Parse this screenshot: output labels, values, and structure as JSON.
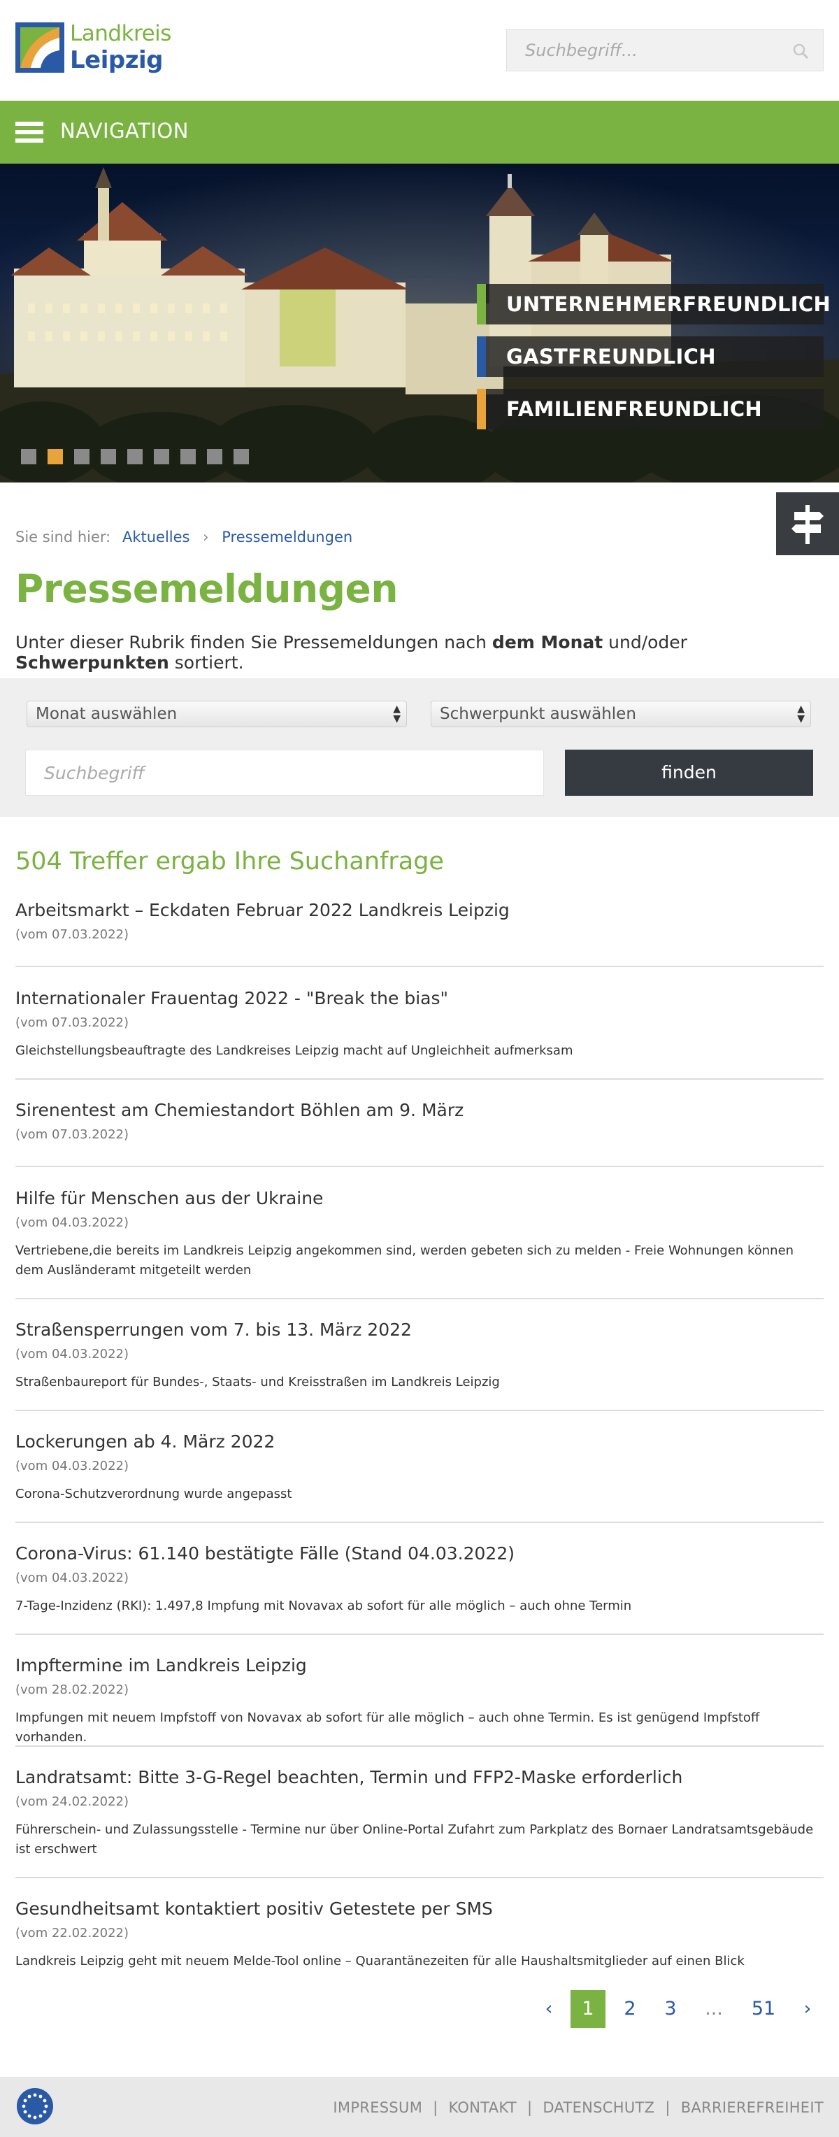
{
  "header": {
    "logo_line1": "Landkreis",
    "logo_line2": "Leipzig",
    "search_placeholder": "Suchbegriff..."
  },
  "nav": {
    "label": "NAVIGATION"
  },
  "hero": {
    "badges": [
      {
        "label": "UNTERNEHMERFREUNDLICH",
        "color": "#7ab341"
      },
      {
        "label": "GASTFREUNDLICH",
        "color": "#2a5aa6"
      },
      {
        "label": "FAMILIENFREUNDLICH",
        "color": "#e8a33b"
      }
    ],
    "slide_count": 9,
    "active_slide": 2
  },
  "breadcrumb": {
    "prefix": "Sie sind hier:",
    "items": [
      "Aktuelles",
      "Pressemeldungen"
    ]
  },
  "page": {
    "title": "Pressemeldungen",
    "intro_1": "Unter dieser Rubrik finden Sie Pressemeldungen nach ",
    "intro_b1": "dem Monat",
    "intro_2": " und/oder ",
    "intro_b2": "Schwerpunkten",
    "intro_3": " sortiert."
  },
  "filter": {
    "month_select": "Monat auswählen",
    "focus_select": "Schwerpunkt auswählen",
    "search_placeholder": "Suchbegriff",
    "find_label": "finden"
  },
  "results": {
    "count_text": "504 Treffer ergab Ihre Suchanfrage",
    "items": [
      {
        "title": "Arbeitsmarkt – Eckdaten Februar 2022 Landkreis Leipzig",
        "date": "(vom 07.03.2022)",
        "summary": ""
      },
      {
        "title": "Internationaler Frauentag 2022 - \"Break the bias\"",
        "date": "(vom 07.03.2022)",
        "summary": "Gleichstellungsbeauftragte des Landkreises Leipzig macht auf Ungleichheit aufmerksam"
      },
      {
        "title": "Sirenentest am Chemiestandort Böhlen am 9. März",
        "date": "(vom 07.03.2022)",
        "summary": ""
      },
      {
        "title": "Hilfe für Menschen aus der Ukraine",
        "date": "(vom 04.03.2022)",
        "summary": "Vertriebene,die bereits im Landkreis Leipzig angekommen sind, werden gebeten sich zu melden - Freie Wohnungen können dem Ausländeramt mitgeteilt werden"
      },
      {
        "title": "Straßensperrungen vom 7. bis 13. März 2022",
        "date": "(vom 04.03.2022)",
        "summary": "Straßenbaureport für Bundes-, Staats- und Kreisstraßen im Landkreis Leipzig"
      },
      {
        "title": "Lockerungen ab 4. März 2022",
        "date": "(vom 04.03.2022)",
        "summary": "Corona-Schutzverordnung wurde angepasst"
      },
      {
        "title": "Corona-Virus: 61.140 bestätigte Fälle (Stand 04.03.2022)",
        "date": "(vom 04.03.2022)",
        "summary": "7-Tage-Inzidenz (RKI): 1.497,8 Impfung mit Novavax ab sofort für alle möglich – auch ohne Termin"
      },
      {
        "title": "Impftermine im Landkreis Leipzig",
        "date": "(vom 28.02.2022)",
        "summary": "Impfungen mit neuem Impfstoff von Novavax ab sofort für alle möglich – auch ohne Termin. Es ist genügend Impfstoff vorhanden."
      },
      {
        "title": "Landratsamt: Bitte 3-G-Regel beachten, Termin und FFP2-Maske erforderlich",
        "date": "(vom 24.02.2022)",
        "summary": "Führerschein- und Zulassungsstelle - Termine nur über Online-Portal Zufahrt zum Parkplatz des Bornaer Landratsamtsgebäude ist erschwert"
      },
      {
        "title": "Gesundheitsamt kontaktiert positiv Getestete per SMS",
        "date": "(vom 22.02.2022)",
        "summary": "Landkreis Leipzig geht mit neuem Melde-Tool online – Quarantänezeiten für alle Haushaltsmitglieder auf einen Blick"
      }
    ]
  },
  "pagination": {
    "prev": "‹",
    "pages": [
      "1",
      "2",
      "3"
    ],
    "ellipsis": "...",
    "last": "51",
    "next": "›",
    "current": "1"
  },
  "footer": {
    "links": [
      "IMPRESSUM",
      "KONTAKT",
      "DATENSCHUTZ",
      "BARRIEREFREIHEIT"
    ],
    "separator": "|"
  },
  "colors": {
    "brand_green": "#7ab341",
    "brand_blue": "#2a5aa6",
    "dark_button": "#363b42"
  }
}
